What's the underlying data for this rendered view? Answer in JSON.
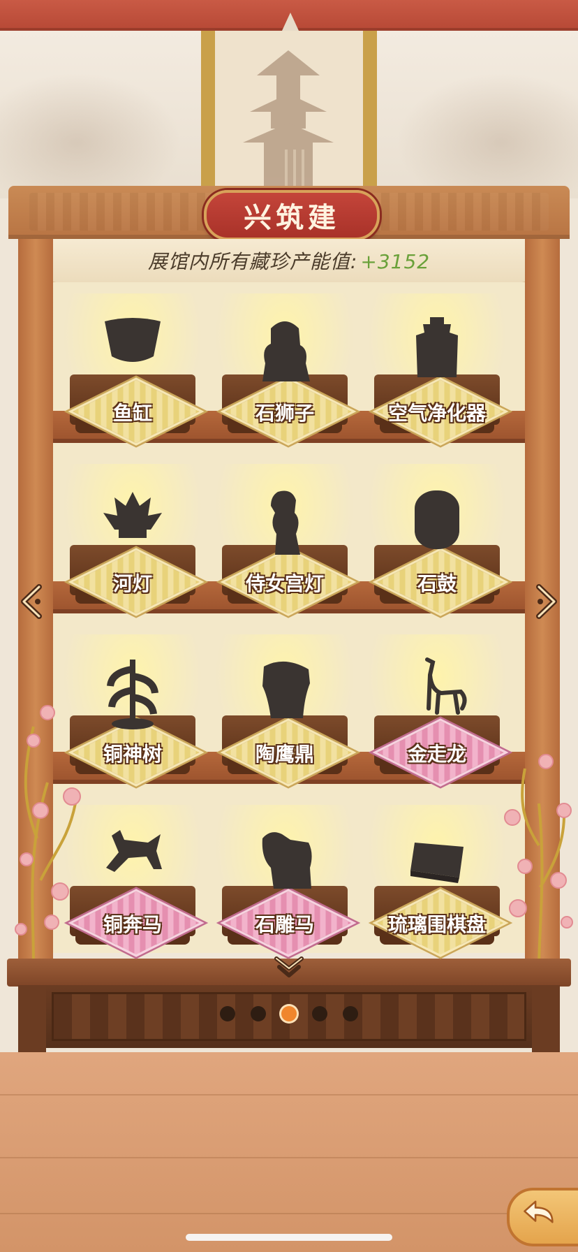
{
  "header": {
    "title": "兴筑建",
    "banner_prefix": "展馆内所有藏珍产能值:",
    "banner_value": "+3152"
  },
  "items": [
    {
      "name": "鱼缸",
      "mat": "gold"
    },
    {
      "name": "石狮子",
      "mat": "gold"
    },
    {
      "name": "空气净化器",
      "mat": "gold"
    },
    {
      "name": "河灯",
      "mat": "gold"
    },
    {
      "name": "侍女宫灯",
      "mat": "gold"
    },
    {
      "name": "石鼓",
      "mat": "gold"
    },
    {
      "name": "铜神树",
      "mat": "gold"
    },
    {
      "name": "陶鹰鼎",
      "mat": "gold"
    },
    {
      "name": "金走龙",
      "mat": "pink"
    },
    {
      "name": "铜奔马",
      "mat": "pink"
    },
    {
      "name": "石雕马",
      "mat": "pink"
    },
    {
      "name": "琉璃围棋盘",
      "mat": "gold"
    }
  ],
  "pagination": {
    "total_pages": 5,
    "current_page": 3
  },
  "colors": {
    "title_plaque": "#b83a2f",
    "banner_value": "#6aa13a",
    "active_dot": "#f0862d",
    "silhouette": "#3a3431",
    "gold_mat": "#e8d27a",
    "pink_mat": "#e58fb0"
  },
  "icons": {
    "nav_prev": "chevron-left-icon",
    "nav_next": "chevron-right-icon",
    "scroll_down": "double-chevron-down-icon",
    "return": "return-arrow-icon"
  }
}
